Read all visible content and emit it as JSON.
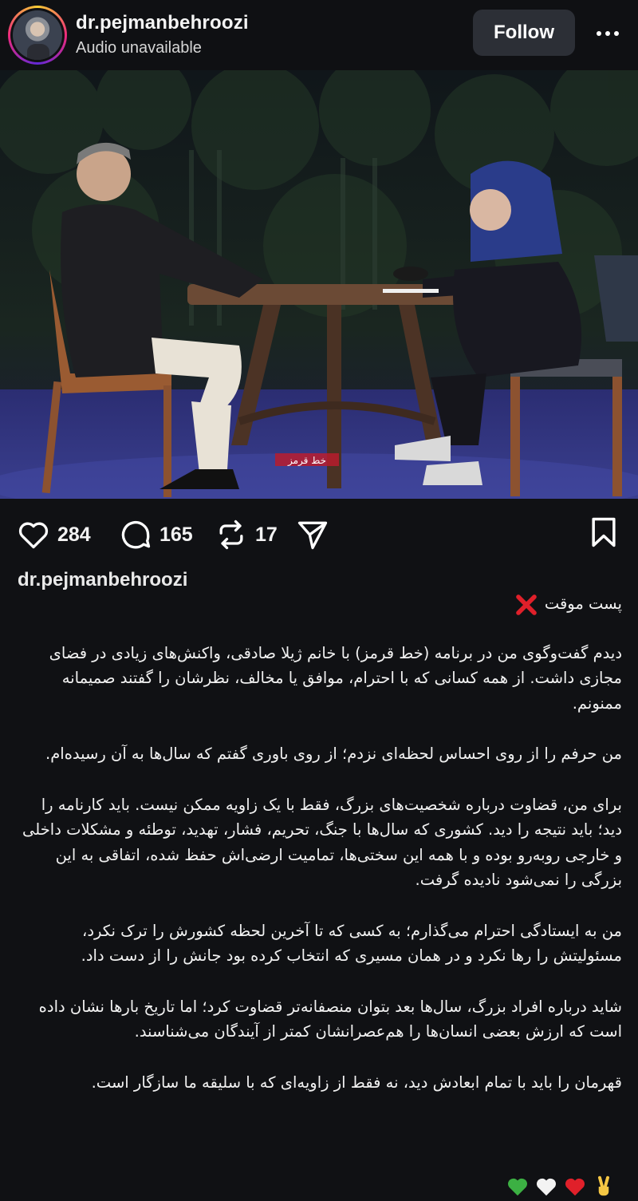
{
  "header": {
    "username": "dr.pejmanbehroozi",
    "subline": "Audio unavailable",
    "follow_label": "Follow",
    "more_icon": "more-horizontal-icon"
  },
  "photo": {
    "overlay_logo_text": "خط قرمز"
  },
  "actions": {
    "likes": "284",
    "comments": "165",
    "reposts": "17",
    "icons": [
      "heart-icon",
      "comment-icon",
      "repost-icon",
      "share-icon",
      "bookmark-icon"
    ]
  },
  "caption": {
    "username": "dr.pejmanbehroozi",
    "title": "پست موقت",
    "paragraphs": [
      "دیدم گفت‌وگوی من در برنامه (خط قرمز) با خانم ژیلا صادقی، واکنش‌های زیادی در فضای مجازی داشت. از همه کسانی که با احترام، موافق یا مخالف، نظرشان را گفتند صمیمانه ممنونم.",
      "من حرفم را از روی احساس لحظه‌ای نزدم؛ از روی باوری گفتم که سال‌ها به آن رسیده‌ام.",
      "برای من، قضاوت درباره شخصیت‌های بزرگ، فقط با یک زاویه ممکن نیست. باید کارنامه را دید؛ باید نتیجه را دید. کشوری که سال‌ها با جنگ، تحریم، فشار، تهدید، توطئه و مشکلات داخلی و خارجی روبه‌رو بوده و با همه این سختی‌ها، تمامیت ارضی‌اش حفظ شده، اتفاقی به این بزرگی را نمی‌شود نادیده گرفت.",
      "من به ایستادگی احترام می‌گذارم؛ به کسی که تا آخرین لحظه کشورش را ترک نکرد، مسئولیتش را رها نکرد و در همان مسیری که انتخاب کرده بود جانش را از دست داد.",
      "شاید درباره افراد بزرگ، سال‌ها بعد بتوان منصفانه‌تر قضاوت کرد؛ اما تاریخ بارها نشان داده است که ارزش بعضی انسان‌ها را هم‌عصرانشان کمتر از آیندگان می‌شناسند.",
      "قهرمان را باید با تمام ابعادش دید، نه فقط از زاویه‌ای که با سلیقه ما سازگار است."
    ],
    "emojis": [
      "victory-hand-emoji",
      "red-heart-emoji",
      "white-heart-emoji",
      "green-heart-emoji"
    ]
  },
  "colors": {
    "background": "#101114",
    "button_bg": "#2c2f36",
    "title_mark": "#e0202a"
  }
}
